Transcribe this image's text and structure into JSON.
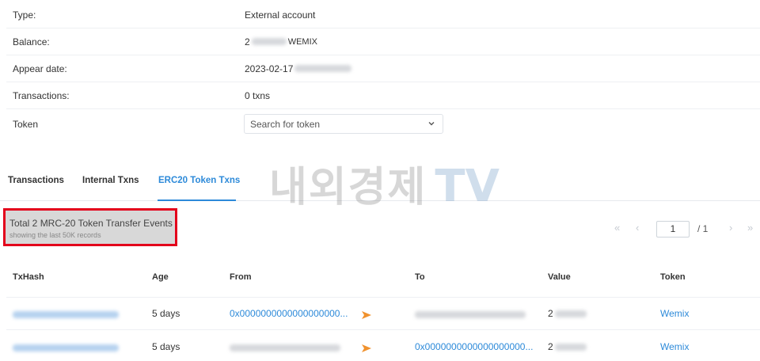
{
  "overview": {
    "type": {
      "label": "Type:",
      "value": "External account"
    },
    "balance": {
      "label": "Balance:",
      "value_prefix": "2",
      "unit": "WEMIX"
    },
    "appear_date": {
      "label": "Appear date:",
      "value": "2023-02-17"
    },
    "transactions": {
      "label": "Transactions:",
      "value": "0 txns"
    },
    "token": {
      "label": "Token",
      "placeholder": "Search for token"
    }
  },
  "tabs": [
    {
      "label": "Transactions",
      "active": false
    },
    {
      "label": "Internal Txns",
      "active": false
    },
    {
      "label": "ERC20 Token Txns",
      "active": true
    }
  ],
  "watermark": {
    "korean": "내외경제",
    "latin": "TV"
  },
  "summary": {
    "title": "Total 2 MRC-20 Token Transfer Events",
    "subtitle": "showing the last 50K records"
  },
  "pagination": {
    "first": "«",
    "prev": "‹",
    "page": "1",
    "of": "/ 1",
    "next": "›",
    "last": "»"
  },
  "table": {
    "headers": [
      "TxHash",
      "Age",
      "From",
      "To",
      "Value",
      "Token"
    ],
    "rows": [
      {
        "age": "5 days",
        "from": "0x0000000000000000000...",
        "to": "",
        "value_prefix": "2",
        "token": "Wemix"
      },
      {
        "age": "5 days",
        "from": "",
        "to": "0x0000000000000000000...",
        "value_prefix": "2",
        "token": "Wemix"
      }
    ]
  },
  "colors": {
    "accent": "#2d8ad9",
    "highlight_border": "#e3001b",
    "arrow": "#f0922e"
  }
}
